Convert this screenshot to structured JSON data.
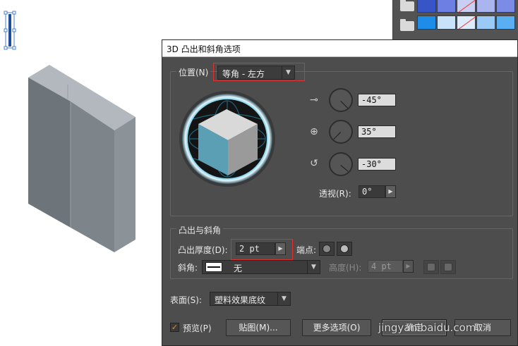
{
  "dialog": {
    "title": "3D 凸出和斜角选项",
    "position": {
      "label": "位置(N)",
      "preset": "等角 - 左方",
      "rot_x": "-45°",
      "rot_y": "35°",
      "rot_z": "-30°",
      "perspective_label": "透视(R):",
      "perspective": "0°"
    },
    "extrude": {
      "group_label": "凸出与斜角",
      "depth_label": "凸出厚度(D):",
      "depth": "2 pt",
      "cap_label": "端点:",
      "bevel_label": "斜角:",
      "bevel": "无",
      "height_label": "高度(H):",
      "height": "4 pt"
    },
    "surface": {
      "label": "表面(S):",
      "value": "塑料效果底纹"
    },
    "preview_label": "预览(P)",
    "preview_checked": true,
    "map_button": "贴图(M)...",
    "more_button": "更多选项(O)",
    "ok_button": "确定",
    "cancel_button": "取消"
  },
  "watermark": "jingyan.baidu.com",
  "colors": {
    "dialog_bg": "#4d4d4d",
    "highlight_border": "#e03030",
    "cube_top": "#d9d9d9",
    "cube_left": "#5a9fb4",
    "cube_right": "#9a9a9a",
    "object_front": "#6d747a",
    "object_side": "#8b9298",
    "object_top": "#b2b8bd"
  },
  "icons": [
    "x-axis-rotation-icon",
    "y-axis-rotation-icon",
    "z-axis-rotation-icon",
    "dropdown-arrow-icon",
    "cap-on-icon",
    "cap-off-icon",
    "checkmark-icon"
  ]
}
